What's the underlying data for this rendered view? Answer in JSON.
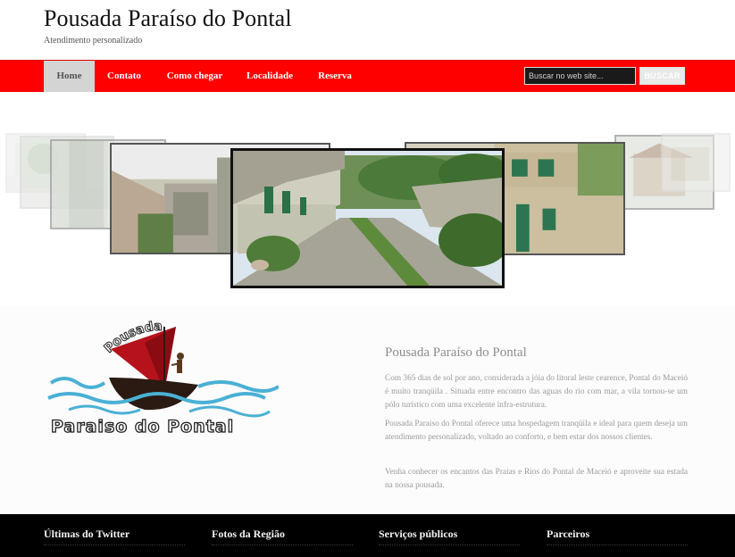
{
  "header": {
    "title": "Pousada Paraíso do Pontal",
    "tagline": "Atendimento personalizado"
  },
  "nav": {
    "items": [
      "Home",
      "Contato",
      "Como chegar",
      "Localidade",
      "Reserva"
    ],
    "active": "Home"
  },
  "search": {
    "placeholder": "Buscar no web site...",
    "button_label": "BUSCAR"
  },
  "logo": {
    "top_word": "Pousada",
    "bottom_words": "Paraiso do Pontal"
  },
  "about": {
    "title": "Pousada Paraíso do Pontal",
    "paragraphs": [
      "Com 365 dias de sol por ano, considerada a jóia do litoral leste cearence, Pontal do Maceió é muito tranqüila . Situada entre encontro das aguas do rio com mar, a vila tornou-se um pólo turístico com uma excelente infra-estrutura.",
      "Pousada Paraiso do Pontal oferece uma hospedagem tranqüila e ideal para quem deseja um atendimento personalizado, voltado ao conforto, e bem estar dos nossos clientes.",
      "Venha conhecer os encantos das Praias e Rios do Pontal de Maceió e aproveite sua estada na nossa pousada."
    ]
  },
  "footer": {
    "columns": [
      "Últimas do Twitter",
      "Fotos da Região",
      "Serviços públicos",
      "Parceiros"
    ]
  },
  "colors": {
    "nav_background": "#ff0000",
    "nav_active": "#d4d4d4",
    "footer_background": "#000000"
  }
}
